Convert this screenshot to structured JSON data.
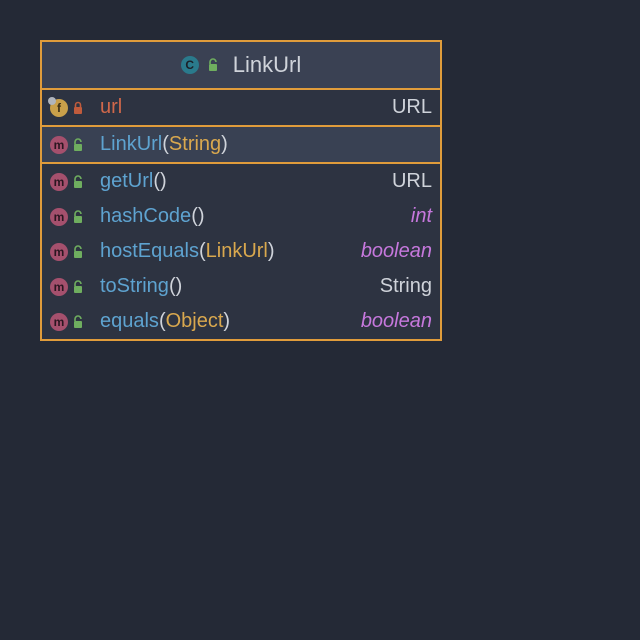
{
  "class": {
    "icon": "c",
    "visibility": "public",
    "name": "LinkUrl"
  },
  "fields": [
    {
      "icon": "f",
      "visibility": "private",
      "name": "url",
      "type": "URL",
      "primitive": false
    }
  ],
  "constructors": [
    {
      "icon": "m",
      "visibility": "public",
      "name": "LinkUrl",
      "params": "String",
      "type": "",
      "primitive": false
    }
  ],
  "methods": [
    {
      "icon": "m",
      "visibility": "public",
      "name": "getUrl",
      "params": "",
      "type": "URL",
      "primitive": false
    },
    {
      "icon": "m",
      "visibility": "public",
      "name": "hashCode",
      "params": "",
      "type": "int",
      "primitive": true
    },
    {
      "icon": "m",
      "visibility": "public",
      "name": "hostEquals",
      "params": "LinkUrl",
      "type": "boolean",
      "primitive": true
    },
    {
      "icon": "m",
      "visibility": "public",
      "name": "toString",
      "params": "",
      "type": "String",
      "primitive": false
    },
    {
      "icon": "m",
      "visibility": "public",
      "name": "equals",
      "params": "Object",
      "type": "boolean",
      "primitive": true
    }
  ],
  "glyphs": {
    "c": "C",
    "f": "f",
    "m": "m"
  }
}
